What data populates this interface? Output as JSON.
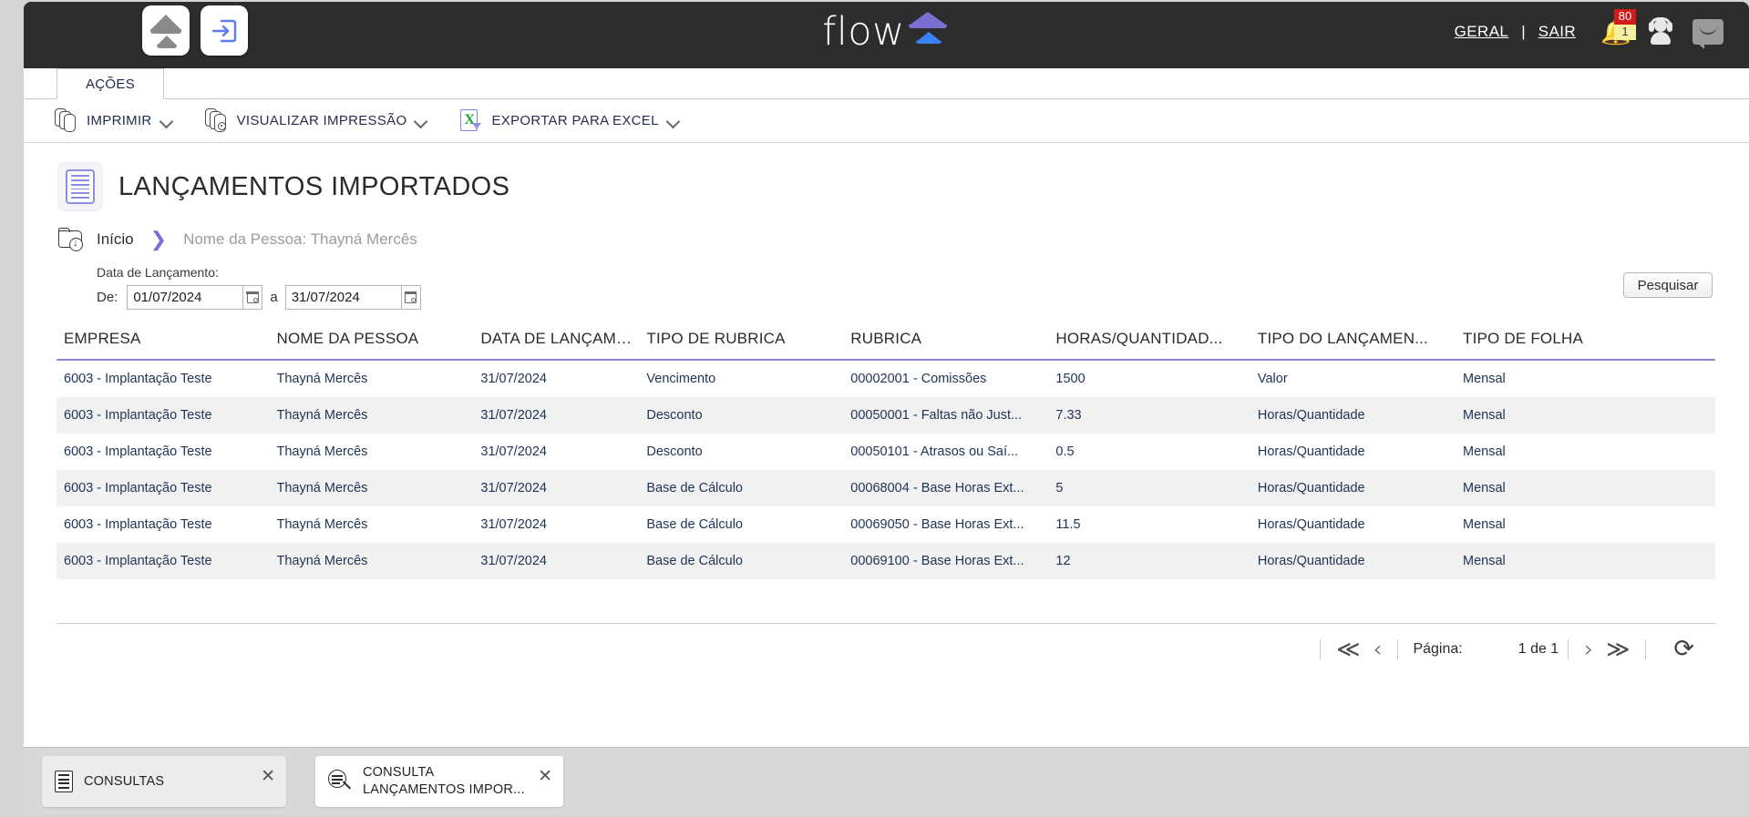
{
  "header": {
    "logo_text": "flow",
    "links": {
      "general": "GERAL",
      "separator": "|",
      "logout": "SAIR"
    },
    "notifications": {
      "badge_red": "80",
      "badge_yellow": "1"
    },
    "colors": {
      "bar_bg": "#2d2d2d",
      "accent_purple": "#7b6fd4",
      "accent_blue": "#3b82f6",
      "badge_red": "#d21b1b",
      "badge_yellow": "#f5f0a0"
    }
  },
  "tabs": {
    "acoes": "AÇÕES"
  },
  "toolbar": {
    "items": [
      {
        "label": "IMPRIMIR",
        "icon": "copies-icon"
      },
      {
        "label": "VISUALIZAR IMPRESSÃO",
        "icon": "preview-icon"
      },
      {
        "label": "EXPORTAR PARA EXCEL",
        "icon": "excel-icon"
      }
    ]
  },
  "page": {
    "title": "LANÇAMENTOS IMPORTADOS",
    "breadcrumb": {
      "home": "Início",
      "separator": "❯",
      "current": "Nome da Pessoa: Thayná Mercês"
    }
  },
  "filter": {
    "label": "Data de Lançamento:",
    "from_label": "De:",
    "from_value": "01/07/2024",
    "to_label": "a",
    "to_value": "31/07/2024",
    "search_button": "Pesquisar"
  },
  "table": {
    "columns": [
      "EMPRESA",
      "NOME DA PESSOA",
      "DATA DE LANÇAMEN...",
      "TIPO DE RUBRICA",
      "RUBRICA",
      "HORAS/QUANTIDAD...",
      "TIPO DO LANÇAMEN...",
      "TIPO DE FOLHA"
    ],
    "rows": [
      [
        "6003 - Implantação Teste",
        "Thayná Mercês",
        "31/07/2024",
        "Vencimento",
        "00002001 - Comissões",
        "1500",
        "Valor",
        "Mensal"
      ],
      [
        "6003 - Implantação Teste",
        "Thayná Mercês",
        "31/07/2024",
        "Desconto",
        "00050001 - Faltas não Just...",
        "7.33",
        "Horas/Quantidade",
        "Mensal"
      ],
      [
        "6003 - Implantação Teste",
        "Thayná Mercês",
        "31/07/2024",
        "Desconto",
        "00050101 - Atrasos ou Saí...",
        "0.5",
        "Horas/Quantidade",
        "Mensal"
      ],
      [
        "6003 - Implantação Teste",
        "Thayná Mercês",
        "31/07/2024",
        "Base de Cálculo",
        "00068004 - Base Horas Ext...",
        "5",
        "Horas/Quantidade",
        "Mensal"
      ],
      [
        "6003 - Implantação Teste",
        "Thayná Mercês",
        "31/07/2024",
        "Base de Cálculo",
        "00069050 - Base Horas Ext...",
        "11.5",
        "Horas/Quantidade",
        "Mensal"
      ],
      [
        "6003 - Implantação Teste",
        "Thayná Mercês",
        "31/07/2024",
        "Base de Cálculo",
        "00069100 - Base Horas Ext...",
        "12",
        "Horas/Quantidade",
        "Mensal"
      ]
    ]
  },
  "pager": {
    "first": "≪",
    "prev": "‹",
    "page_label": "Página:",
    "page_value": "1 de 1",
    "next": "›",
    "last": "≫",
    "refresh": "⟳"
  },
  "taskbar": {
    "items": [
      {
        "label": "CONSULTAS",
        "icon": "list-icon",
        "close": "✕",
        "active": false
      },
      {
        "label": "CONSULTA\nLANÇAMENTOS IMPOR...",
        "icon": "search-doc-icon",
        "close": "✕",
        "active": true
      }
    ],
    "item1_label": "CONSULTAS",
    "item2_line1": "CONSULTA",
    "item2_line2": "LANÇAMENTOS IMPOR...",
    "close": "✕"
  }
}
